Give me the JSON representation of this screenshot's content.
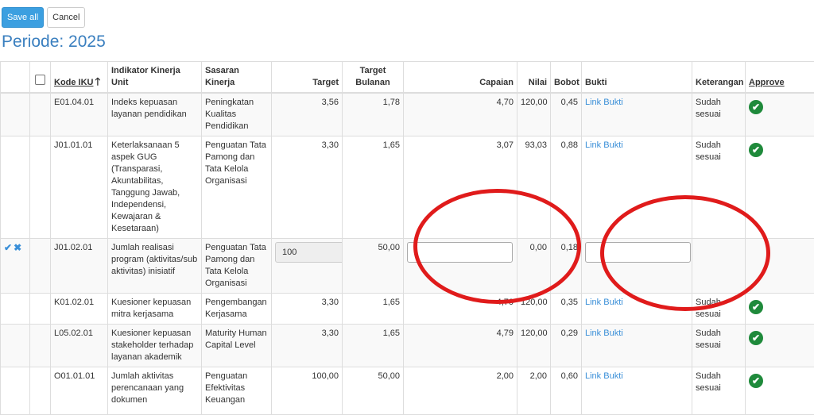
{
  "toolbar": {
    "save_label": "Save all",
    "cancel_label": "Cancel"
  },
  "period": "Periode: 2025",
  "columns": {
    "kode": "Kode IKU",
    "indikator": "Indikator Kinerja Unit",
    "sasaran": "Sasaran Kinerja",
    "target": "Target",
    "target_bulanan": "Target Bulanan",
    "capaian": "Capaian",
    "nilai": "Nilai",
    "bobot": "Bobot",
    "bukti": "Bukti",
    "keterangan": "Keterangan",
    "approve": "Approve"
  },
  "sort_arrow": "🡑",
  "rows": [
    {
      "kode": "E01.04.01",
      "indikator": "Indeks kepuasan layanan pendidikan",
      "sasaran": "Peningkatan Kualitas Pendidikan",
      "target": "3,56",
      "target_bulanan": "1,78",
      "capaian": "4,70",
      "nilai": "120,00",
      "bobot": "0,45",
      "bukti": "Link Bukti",
      "keterangan": "Sudah sesuai"
    },
    {
      "kode": "J01.01.01",
      "indikator": "Keterlaksanaan 5 aspek GUG (Transparasi, Akuntabilitas, Tanggung Jawab, Independensi, Kewajaran & Kesetaraan)",
      "sasaran": "Penguatan Tata Pamong dan Tata Kelola Organisasi",
      "target": "3,30",
      "target_bulanan": "1,65",
      "capaian": "3,07",
      "nilai": "93,03",
      "bobot": "0,88",
      "bukti": "Link Bukti",
      "keterangan": "Sudah sesuai"
    },
    {
      "kode": "J01.02.01",
      "indikator": "Jumlah realisasi program (aktivitas/sub aktivitas) inisiatif",
      "sasaran": "Penguatan Tata Pamong dan Tata Kelola Organisasi",
      "target_input": "100",
      "target_bulanan": "50,00",
      "nilai": "0,00",
      "bobot": "0,18"
    },
    {
      "kode": "K01.02.01",
      "indikator": "Kuesioner kepuasan mitra kerjasama",
      "sasaran": "Pengembangan Kerjasama",
      "target": "3,30",
      "target_bulanan": "1,65",
      "capaian": "4,70",
      "nilai": "120,00",
      "bobot": "0,35",
      "bukti": "Link Bukti",
      "keterangan": "Sudah sesuai"
    },
    {
      "kode": "L05.02.01",
      "indikator": "Kuesioner kepuasan stakeholder terhadap layanan akademik",
      "sasaran": "Maturity Human Capital Level",
      "target": "3,30",
      "target_bulanan": "1,65",
      "capaian": "4,79",
      "nilai": "120,00",
      "bobot": "0,29",
      "bukti": "Link Bukti",
      "keterangan": "Sudah sesuai"
    },
    {
      "kode": "O01.01.01",
      "indikator": "Jumlah aktivitas perencanaan yang dokumen",
      "sasaran": "Penguatan Efektivitas Keuangan",
      "target": "100,00",
      "target_bulanan": "50,00",
      "capaian": "2,00",
      "nilai": "2,00",
      "bobot": "0,60",
      "bukti": "Link Bukti",
      "keterangan": "Sudah sesuai"
    }
  ],
  "edit_actions": {
    "ok": "✔",
    "cancel": "✖"
  },
  "approve_icon": "✔",
  "colors": {
    "primary": "#3c9fe0",
    "link": "#3a8fd8",
    "approve": "#1f8a3b",
    "annotation": "#e01b1b"
  }
}
